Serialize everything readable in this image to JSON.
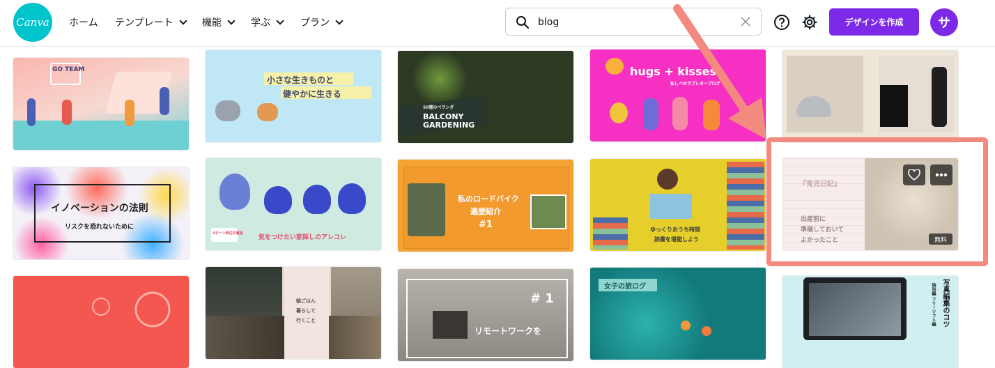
{
  "brand": {
    "logo": "Canva"
  },
  "nav": [
    "ホーム",
    "テンプレート",
    "機能",
    "学ぶ",
    "プラン"
  ],
  "search": {
    "value": "blog"
  },
  "header": {
    "create_label": "デザインを作成",
    "avatar_initial": "サ"
  },
  "cards": {
    "c1": {
      "text": "GO TEAM"
    },
    "c2": {
      "line1": "小さな生きものと",
      "line2": "健やかに生きる"
    },
    "c3": {
      "small": "50種のベランダ",
      "title1": "BALCONY",
      "title2": "GARDENING"
    },
    "c4": {
      "title": "hugs + kisses",
      "subtitle": "私しべのラブレターブログ"
    },
    "c6": {
      "title": "イノベーションの法則",
      "subtitle": "リスクを恐れないために"
    },
    "c7": {
      "badge": "Uターン移住の裏話",
      "caption": "気をつけたい家探しのアレコレ"
    },
    "c8": {
      "line1": "私のロードバイク",
      "line2": "遍歴紹介",
      "num": "#1"
    },
    "c9": {
      "line1": "ゆっくりおうち時間",
      "line2": "読書を堪能しよう"
    },
    "c10": {
      "title": "『育児日記』",
      "line1": "出産前に",
      "line2": "準備しておいて",
      "line3": "よかったこと",
      "badge": "無料"
    },
    "c12": {
      "line1": "朝ごはん",
      "line2": "暮らして",
      "line3": "行くこと"
    },
    "c13": {
      "num": "# 1",
      "caption": "リモートワークを"
    },
    "c14": {
      "title": "女子の旅ログ"
    },
    "c15": {
      "title": "写真編集のコツ",
      "sub": "特別編 フリーソフト編"
    }
  },
  "colors": {
    "accent": "#7d2ae8",
    "logo": "#00c4cc",
    "highlight": "#f38a80"
  }
}
